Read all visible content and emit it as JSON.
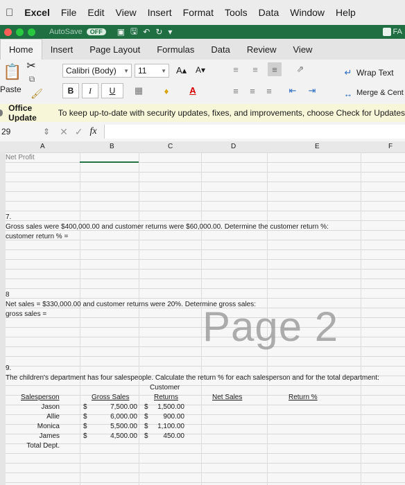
{
  "menu": {
    "app": "Excel",
    "items": [
      "File",
      "Edit",
      "View",
      "Insert",
      "Format",
      "Tools",
      "Data",
      "Window",
      "Help"
    ]
  },
  "titlebar": {
    "autosave": "AutoSave",
    "autosave_state": "OFF",
    "right_text": "FA"
  },
  "ribbon_tabs": [
    "Home",
    "Insert",
    "Page Layout",
    "Formulas",
    "Data",
    "Review",
    "View"
  ],
  "ribbon": {
    "paste": "Paste",
    "font": "Calibri (Body)",
    "size": "11",
    "bold": "B",
    "italic": "I",
    "underline": "U",
    "wrap_text": "Wrap Text",
    "merge": "Merge & Cent",
    "grow": "A▴",
    "shrink": "A▾"
  },
  "banner": {
    "title": "Office Update",
    "message": "To keep up-to-date with security updates, fixes, and improvements, choose Check for Updates"
  },
  "formula_bar": {
    "name_box": "29",
    "fx": "fx",
    "value": ""
  },
  "columns": [
    "A",
    "B",
    "C",
    "D",
    "E",
    "F"
  ],
  "sheet": {
    "top_label": "Net Profit",
    "q7_num": "7.",
    "q7_text": "Gross sales were $400,000.00 and customer returns were $60,000.00. Determine the customer return %:",
    "q7_ans": "customer return % =",
    "q8_num": "8",
    "q8_text": "Net sales = $330,000.00 and customer returns were 20%. Determine gross sales:",
    "q8_ans": "gross sales =",
    "watermark": "Page 2",
    "q9_num": "9.",
    "q9_text": "The children's department has four salespeople. Calculate the return % for each salesperson and for the total department:",
    "table": {
      "header_top": "Customer",
      "headers": [
        "Salesperson",
        "Gross Sales",
        "Returns",
        "Net Sales",
        "Return %"
      ],
      "rows": [
        {
          "name": "Jason",
          "gross": "7,500.00",
          "returns": "1,500.00"
        },
        {
          "name": "Allie",
          "gross": "6,000.00",
          "returns": "900.00"
        },
        {
          "name": "Monica",
          "gross": "5,500.00",
          "returns": "1,100.00"
        },
        {
          "name": "James",
          "gross": "4,500.00",
          "returns": "450.00"
        }
      ],
      "total_label": "Total Dept.",
      "currency": "$"
    }
  }
}
